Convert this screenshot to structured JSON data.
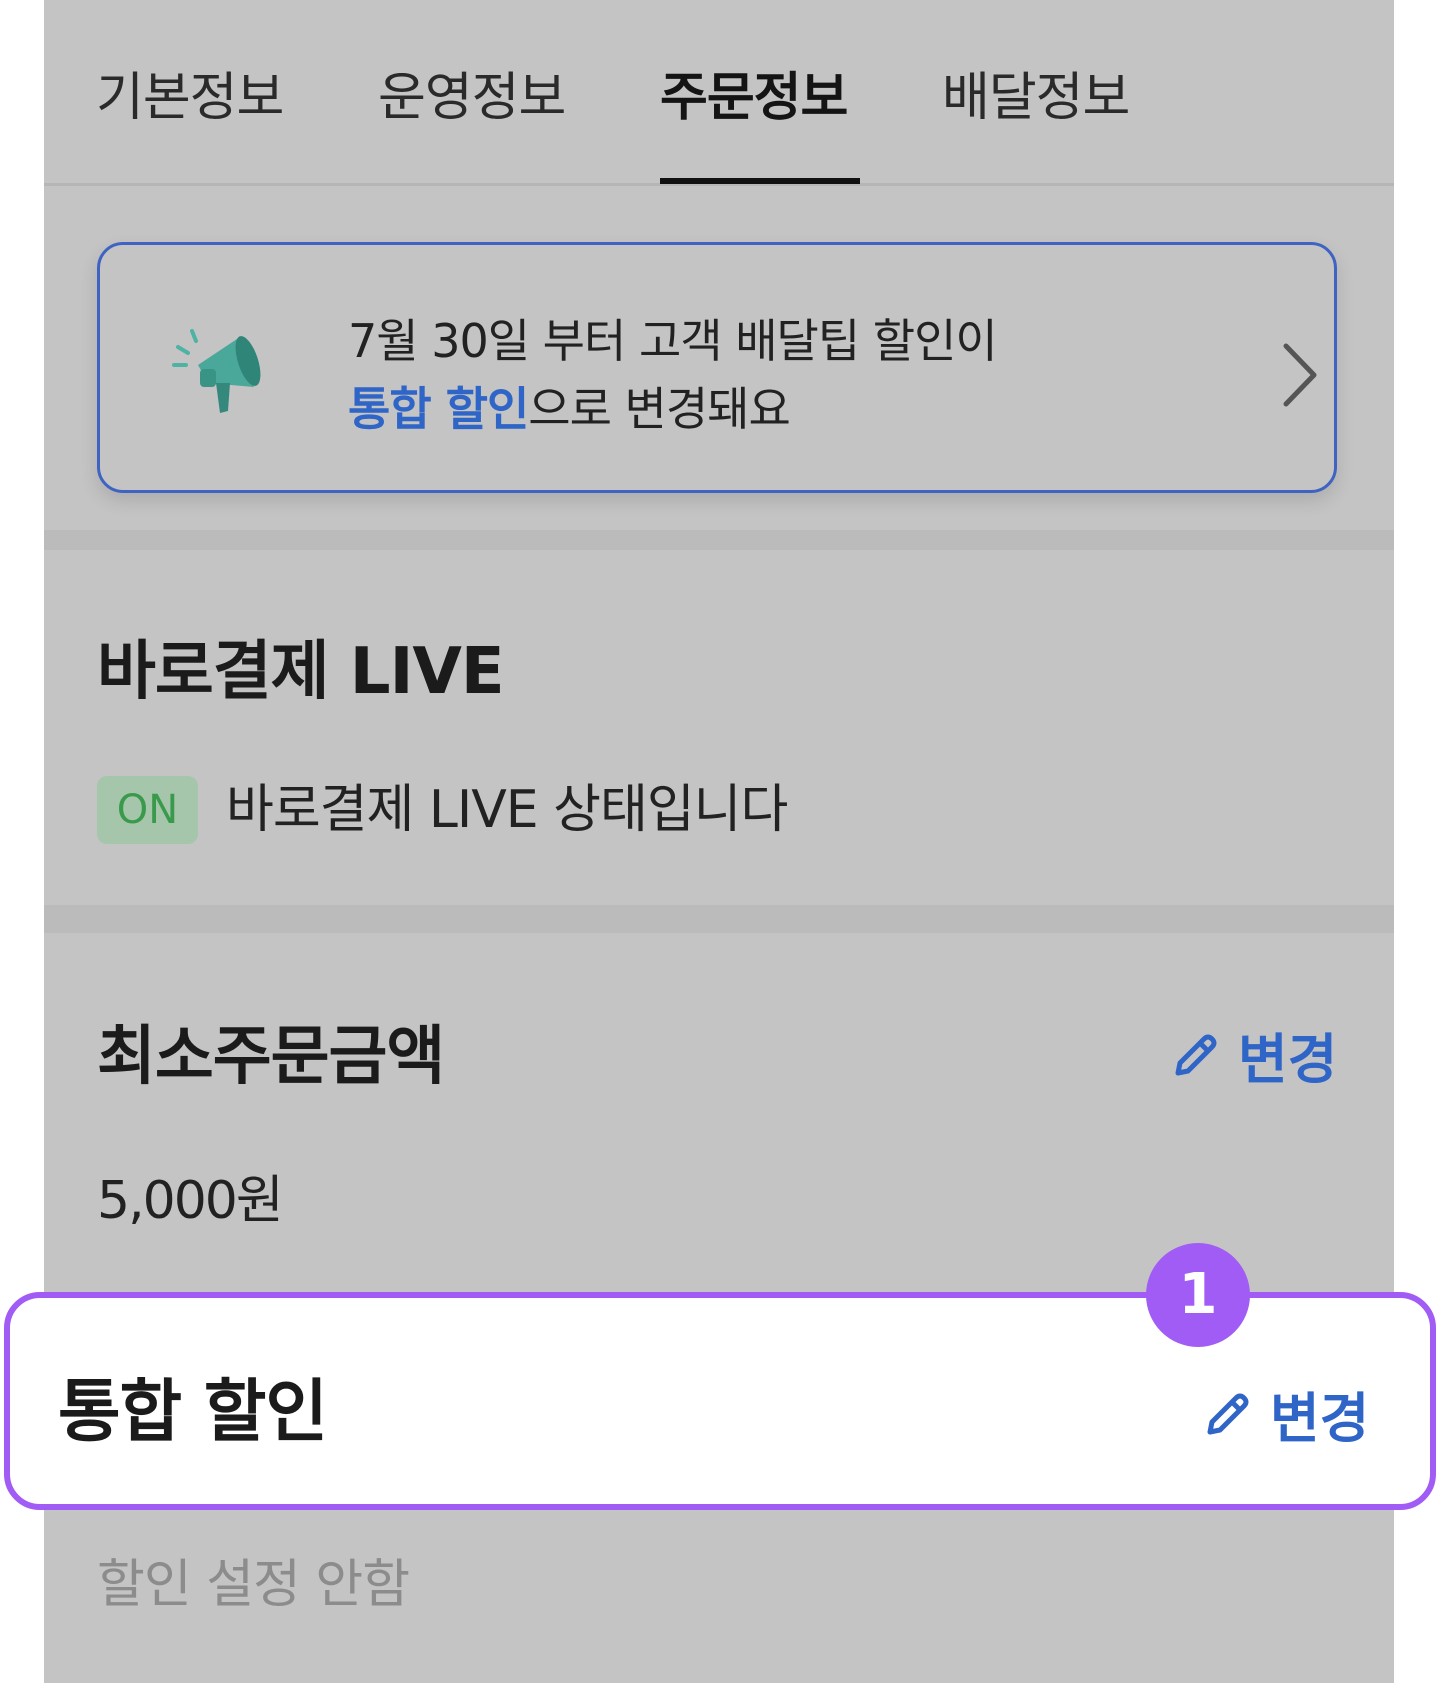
{
  "tabs": [
    {
      "label": "기본정보",
      "active": false
    },
    {
      "label": "운영정보",
      "active": false
    },
    {
      "label": "주문정보",
      "active": true
    },
    {
      "label": "배달정보",
      "active": false
    }
  ],
  "notice": {
    "line1": "7월 30일 부터 고객 배달팁 할인이",
    "line2_highlight": "통합 할인",
    "line2_rest": "으로 변경돼요",
    "icon": "megaphone-icon"
  },
  "live_section": {
    "title": "바로결제 LIVE",
    "badge": "ON",
    "status_text": "바로결제 LIVE 상태입니다"
  },
  "min_order_section": {
    "title": "최소주문금액",
    "change_label": "변경",
    "value": "5,000원"
  },
  "discount_section": {
    "title": "통합 할인",
    "change_label": "변경",
    "value": "할인 설정 안함",
    "step_number": "1"
  },
  "colors": {
    "accent_blue": "#2f65c7",
    "highlight_purple": "#a15cf5",
    "on_badge_bg": "#a6c6ab",
    "on_badge_text": "#3a9a4c",
    "overlay_gray": "#c4c4c4"
  }
}
